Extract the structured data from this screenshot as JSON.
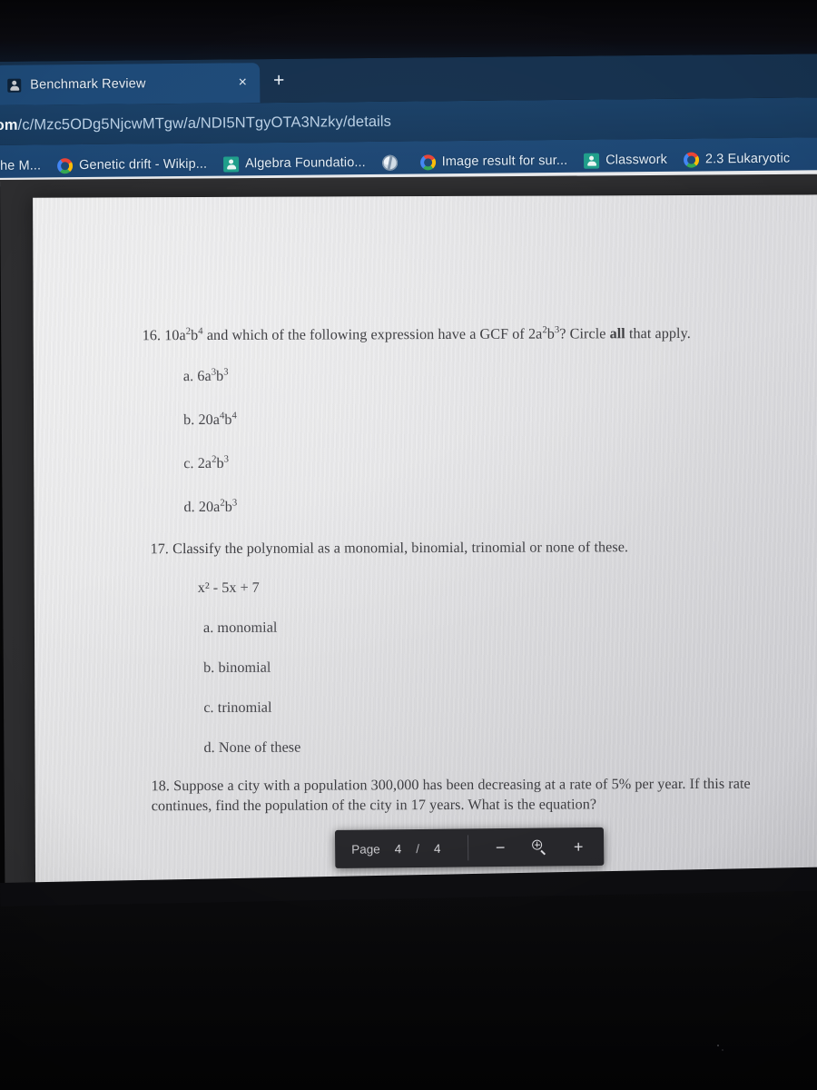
{
  "browser": {
    "tab": {
      "title": "Benchmark Review",
      "favicon": "classroom-icon",
      "close_label": "×"
    },
    "new_tab_label": "+",
    "url": {
      "visible_text": "om/c/Mzc5ODg5NjcwMTgw/a/NDI5NTgyOTA3Nzky/details",
      "host_fragment": "om",
      "path_fragment": "/c/Mzc5ODg5NjcwMTgw/a/NDI5NTgyOTA3Nzky/details"
    },
    "bookmarks": [
      {
        "label": "he M...",
        "icon": "none"
      },
      {
        "label": "Genetic drift - Wikip...",
        "icon": "google-icon"
      },
      {
        "label": "Algebra Foundatio...",
        "icon": "classroom-icon"
      },
      {
        "label": "",
        "icon": "globe-icon"
      },
      {
        "label": "Image result for sur...",
        "icon": "google-icon"
      },
      {
        "label": "Classwork",
        "icon": "classroom-icon"
      },
      {
        "label": "2.3 Eukaryotic",
        "icon": "google-icon"
      }
    ],
    "colors": {
      "tabstrip": "#16314e",
      "active_tab": "#1e4a78",
      "urlbar": "#1a4067",
      "bookmarks_bar": "#1d4875"
    }
  },
  "document": {
    "questions": [
      {
        "number": "16.",
        "stem_pre": "10a",
        "stem_text": "10a²b⁴ and which of the following expression have a GCF of 2a²b³? Circle all that apply.",
        "emphasis_word": "all",
        "options": [
          {
            "letter": "a.",
            "text": "6a³b³"
          },
          {
            "letter": "b.",
            "text": "20a⁴b⁴"
          },
          {
            "letter": "c.",
            "text": "2a²b³"
          },
          {
            "letter": "d.",
            "text": "20a²b³"
          }
        ]
      },
      {
        "number": "17.",
        "stem_text": "Classify the polynomial as a monomial, binomial, trinomial or none of these.",
        "expression": "x² - 5x + 7",
        "options": [
          {
            "letter": "a.",
            "text": "monomial"
          },
          {
            "letter": "b.",
            "text": "binomial"
          },
          {
            "letter": "c.",
            "text": "trinomial"
          },
          {
            "letter": "d.",
            "text": "None of these"
          }
        ]
      },
      {
        "number": "18.",
        "stem_text": "Suppose a city with a population 300,000 has been decreasing at a rate of 5% per year. If this rate continues, find the population of the city in 17 years. What is the equation?",
        "options": []
      }
    ]
  },
  "pdf_toolbar": {
    "page_label": "Page",
    "current_page": "4",
    "separator": "/",
    "total_pages": "4",
    "zoom_out_label": "−",
    "zoom_icon": "zoom-in-icon",
    "zoom_in_label": "+"
  }
}
